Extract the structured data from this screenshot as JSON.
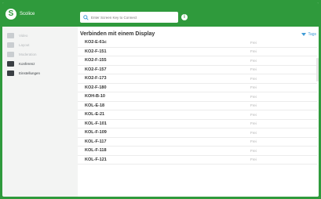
{
  "brand": {
    "name": "Scolice"
  },
  "search": {
    "placeholder": "Enter Screen Key to Connect"
  },
  "sidebar": {
    "items": [
      {
        "label": "Video",
        "icon": "video-icon",
        "active": false
      },
      {
        "label": "Layout",
        "icon": "layout-icon",
        "active": false
      },
      {
        "label": "Moderation",
        "icon": "users-icon",
        "active": false
      },
      {
        "label": "Konferenz",
        "icon": "camera-icon",
        "active": true
      },
      {
        "label": "Einstellungen",
        "icon": "gear-icon",
        "active": true
      }
    ]
  },
  "main": {
    "title": "Verbinden mit einem Display",
    "tags_label": "Tags",
    "rows": [
      {
        "name": "KO2-E-61c",
        "status": "Frei"
      },
      {
        "name": "KO2-F-151",
        "status": "Frei"
      },
      {
        "name": "KO2-F-155",
        "status": "Frei"
      },
      {
        "name": "KO2-F-157",
        "status": "Frei"
      },
      {
        "name": "KO2-F-173",
        "status": "Frei"
      },
      {
        "name": "KO2-F-180",
        "status": "Frei"
      },
      {
        "name": "KOH-B-10",
        "status": "Frei"
      },
      {
        "name": "KOL-E-18",
        "status": "Frei"
      },
      {
        "name": "KOL-E-21",
        "status": "Frei"
      },
      {
        "name": "KOL-F-101",
        "status": "Frei"
      },
      {
        "name": "KOL-F-109",
        "status": "Frei"
      },
      {
        "name": "KOL-F-117",
        "status": "Frei"
      },
      {
        "name": "KOL-F-118",
        "status": "Frei"
      },
      {
        "name": "KOL-F-121",
        "status": "Frei"
      }
    ]
  },
  "colors": {
    "brand": "#2f9a3c",
    "accent": "#3f9bd6"
  }
}
